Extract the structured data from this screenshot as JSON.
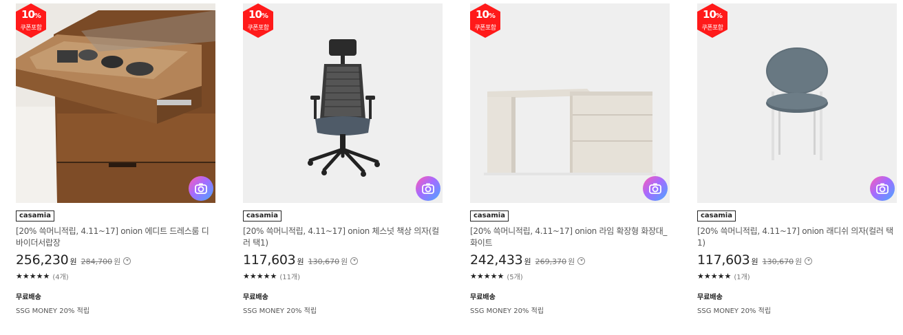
{
  "badge": {
    "pct": "10",
    "pct_sign": "%",
    "text": "쿠폰포함",
    "color": "#ff1a1a"
  },
  "products": [
    {
      "brand": "casamia",
      "title": "[20% 쓱머니적립, 4.11~17] onion 에디트 드레스룸 디바이더서랍장",
      "price": "256,230",
      "won": "원",
      "original_price": "284,700",
      "original_won": "원",
      "stars": "★★★★★",
      "review_count": "(4개)",
      "shipping": "무료배송",
      "point": "SSG MONEY 20% 적립"
    },
    {
      "brand": "casamia",
      "title": "[20% 쓱머니적립, 4.11~17] onion 체스넛 책상 의자(컬러 택1)",
      "price": "117,603",
      "won": "원",
      "original_price": "130,670",
      "original_won": "원",
      "stars": "★★★★★",
      "review_count": "(11개)",
      "shipping": "무료배송",
      "point": "SSG MONEY 20% 적립"
    },
    {
      "brand": "casamia",
      "title": "[20% 쓱머니적립, 4.11~17] onion 라임 확장형 화장대_화이트",
      "price": "242,433",
      "won": "원",
      "original_price": "269,370",
      "original_won": "원",
      "stars": "★★★★★",
      "review_count": "(5개)",
      "shipping": "무료배송",
      "point": "SSG MONEY 20% 적립"
    },
    {
      "brand": "casamia",
      "title": "[20% 쓱머니적립, 4.11~17] onion 래디쉬 의자(컬러 택1)",
      "price": "117,603",
      "won": "원",
      "original_price": "130,670",
      "original_won": "원",
      "stars": "★★★★★",
      "review_count": "(1개)",
      "shipping": "무료배송",
      "point": "SSG MONEY 20% 적립"
    }
  ]
}
